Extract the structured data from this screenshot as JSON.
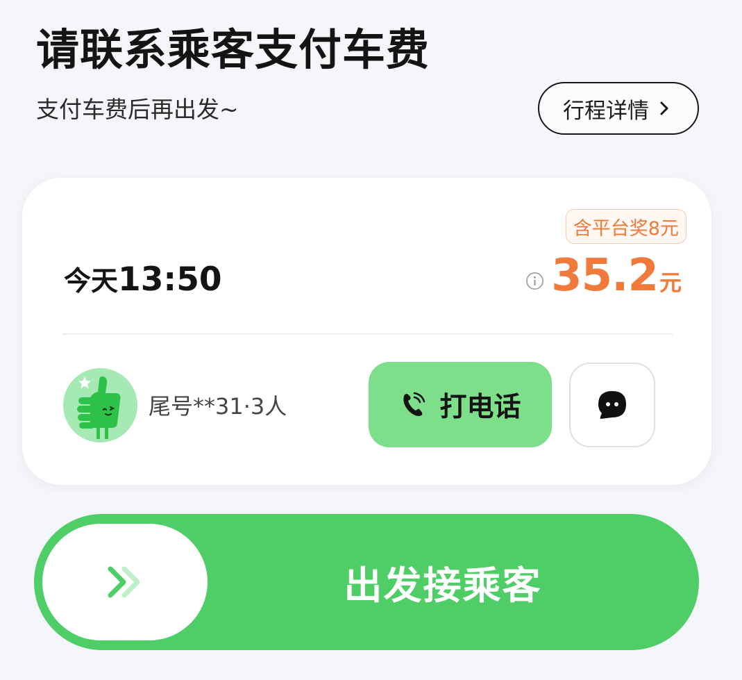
{
  "header": {
    "title": "请联系乘客支付车费",
    "subtitle": "支付车费后再出发~",
    "detail_button_label": "行程详情"
  },
  "order_card": {
    "bonus_tag": "含平台奖8元",
    "time_prefix": "今天",
    "time_value": "13:50",
    "price_amount": "35.2",
    "price_unit": "元",
    "passenger_label": "尾号**31·3人",
    "call_button_label": "打电话"
  },
  "slider": {
    "label": "出发接乘客"
  },
  "colors": {
    "page_bg": "#f4f6fa",
    "accent_green": "#4fcd66",
    "call_green": "#7ddf8a",
    "price_orange": "#ef7a3b"
  },
  "icons": {
    "detail_chevron": "chevron-right-icon",
    "info": "info-icon",
    "phone": "phone-icon",
    "message": "chat-bubble-icon",
    "slider": "double-chevron-right-icon",
    "avatar": "thumbs-up-avatar"
  }
}
